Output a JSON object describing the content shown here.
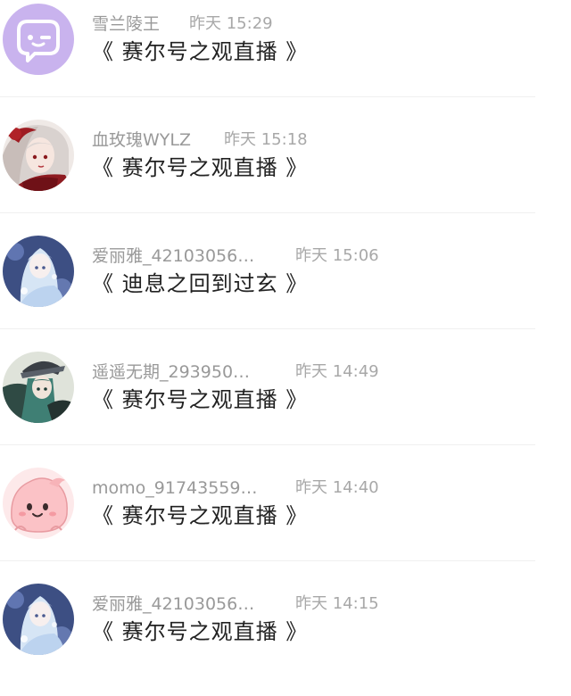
{
  "messages": [
    {
      "username": "雪兰陵王",
      "time": "昨天 15:29",
      "text": "《 赛尔号之观直播 》",
      "avatar": "purple-chat-bubble-icon"
    },
    {
      "username": "血玫瑰WYLZ",
      "time": "昨天 15:18",
      "text": "《 赛尔号之观直播 》",
      "avatar": "anime-avatar-red"
    },
    {
      "username": "爱丽雅_42103056…",
      "time": "昨天 15:06",
      "text": "《 迪息之回到过玄 》",
      "avatar": "anime-avatar-blue"
    },
    {
      "username": "遥遥无期_293950…",
      "time": "昨天 14:49",
      "text": "《 赛尔号之观直播 》",
      "avatar": "anime-avatar-green"
    },
    {
      "username": "momo_91743559…",
      "time": "昨天 14:40",
      "text": "《 赛尔号之观直播 》",
      "avatar": "pink-blob-avatar"
    },
    {
      "username": "爱丽雅_42103056…",
      "time": "昨天 14:15",
      "text": "《 赛尔号之观直播 》",
      "avatar": "anime-avatar-blue"
    }
  ],
  "colors": {
    "username": "#999999",
    "time": "#a8a8a8",
    "message": "#222222",
    "divider": "#f0f0f0",
    "avatar_purple": "#c9b3ee"
  }
}
